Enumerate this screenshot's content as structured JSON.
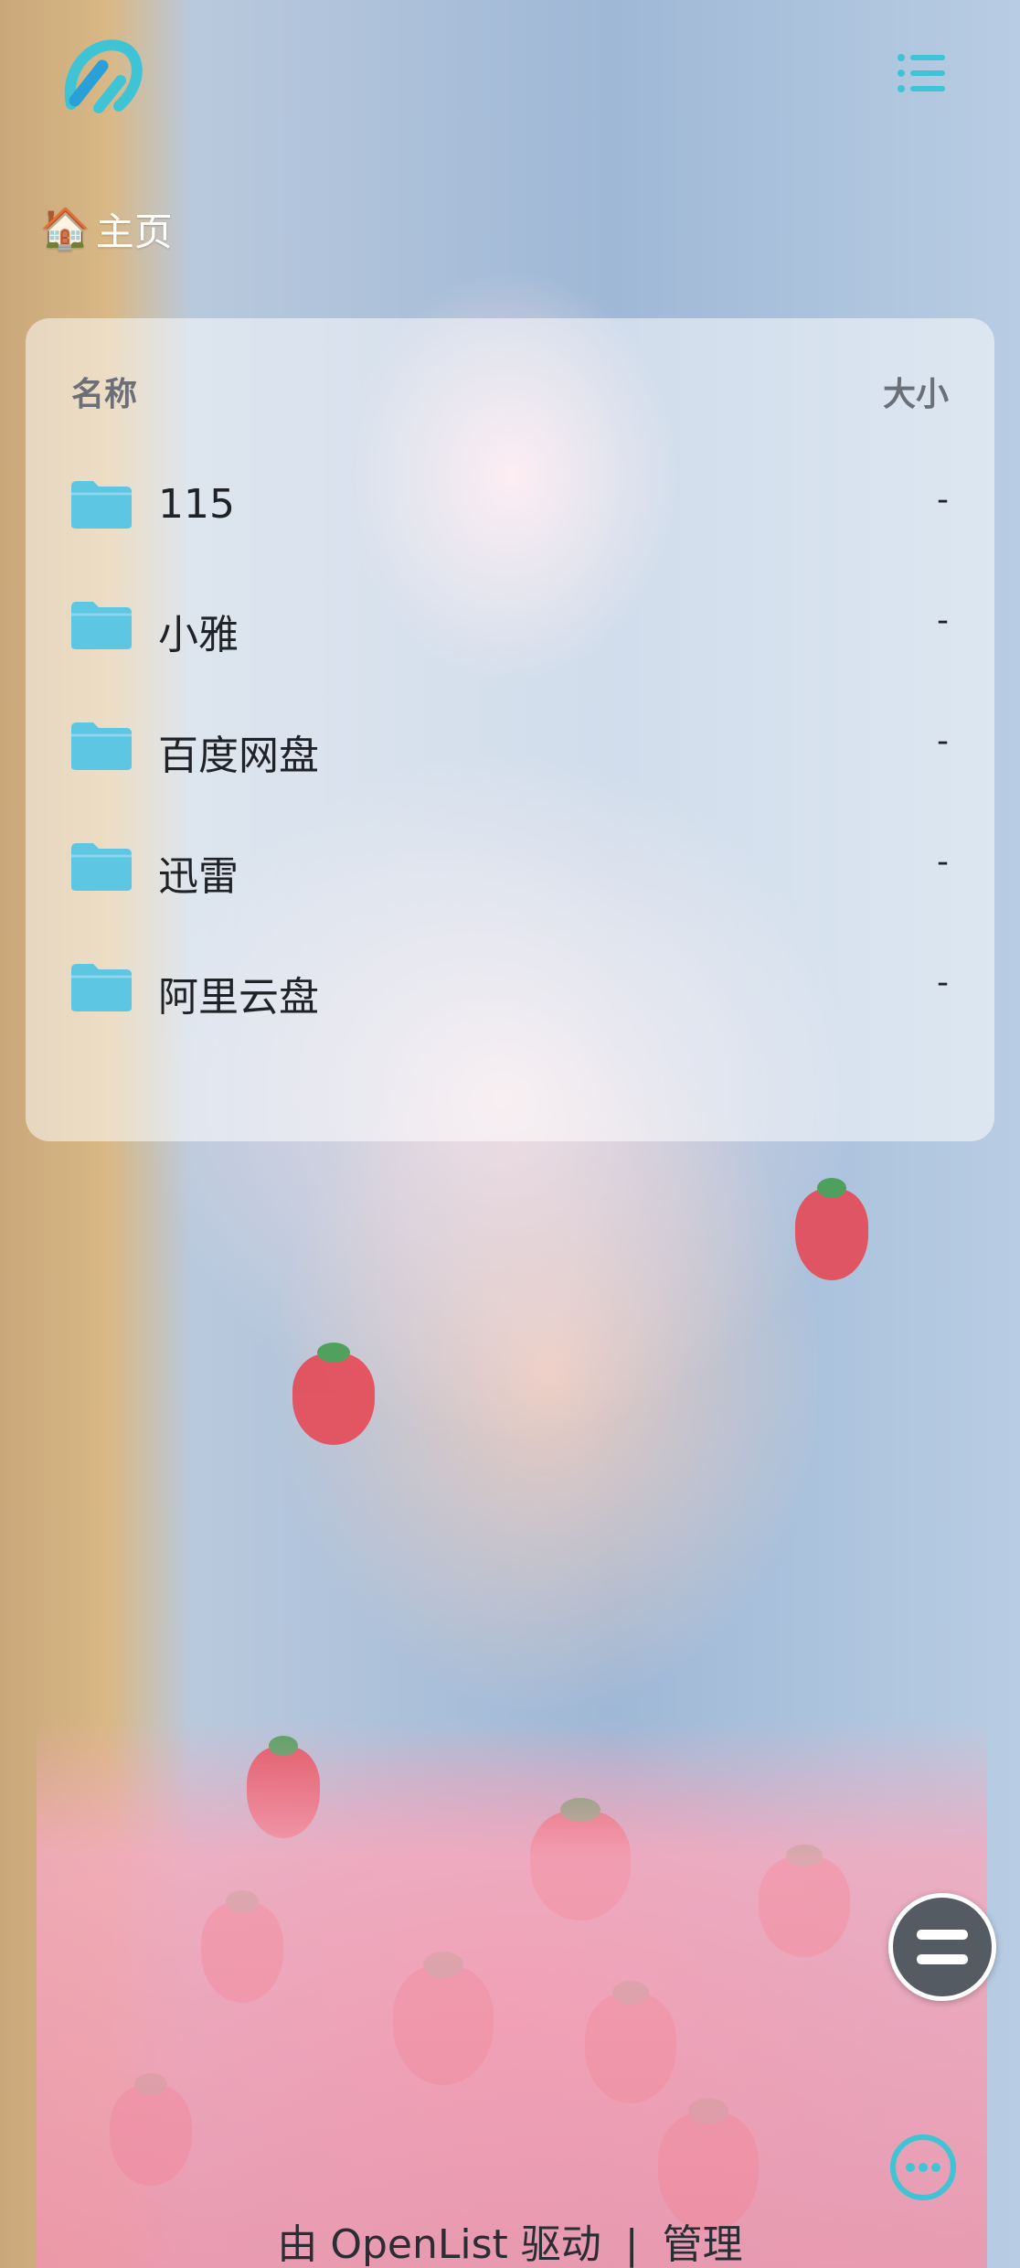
{
  "header": {
    "logo_icon": "openlist-logo-icon",
    "menu_icon": "list-menu-icon",
    "accent_color": "#3fc4d6"
  },
  "breadcrumb": {
    "home_icon": "house-icon",
    "home_emoji": "🏠",
    "home_label": "主页"
  },
  "table": {
    "col_name": "名称",
    "col_size": "大小",
    "rows": [
      {
        "icon": "folder-icon",
        "name": "115",
        "size": "-"
      },
      {
        "icon": "folder-icon",
        "name": "小雅",
        "size": "-"
      },
      {
        "icon": "folder-icon",
        "name": "百度网盘",
        "size": "-"
      },
      {
        "icon": "folder-icon",
        "name": "迅雷",
        "size": "-"
      },
      {
        "icon": "folder-icon",
        "name": "阿里云盘",
        "size": "-"
      }
    ]
  },
  "floating": {
    "main_icon": "double-bar-icon",
    "more_icon": "more-dots-icon"
  },
  "footer": {
    "powered_by": "由 OpenList 驱动",
    "separator": "|",
    "manage_link": "管理"
  }
}
